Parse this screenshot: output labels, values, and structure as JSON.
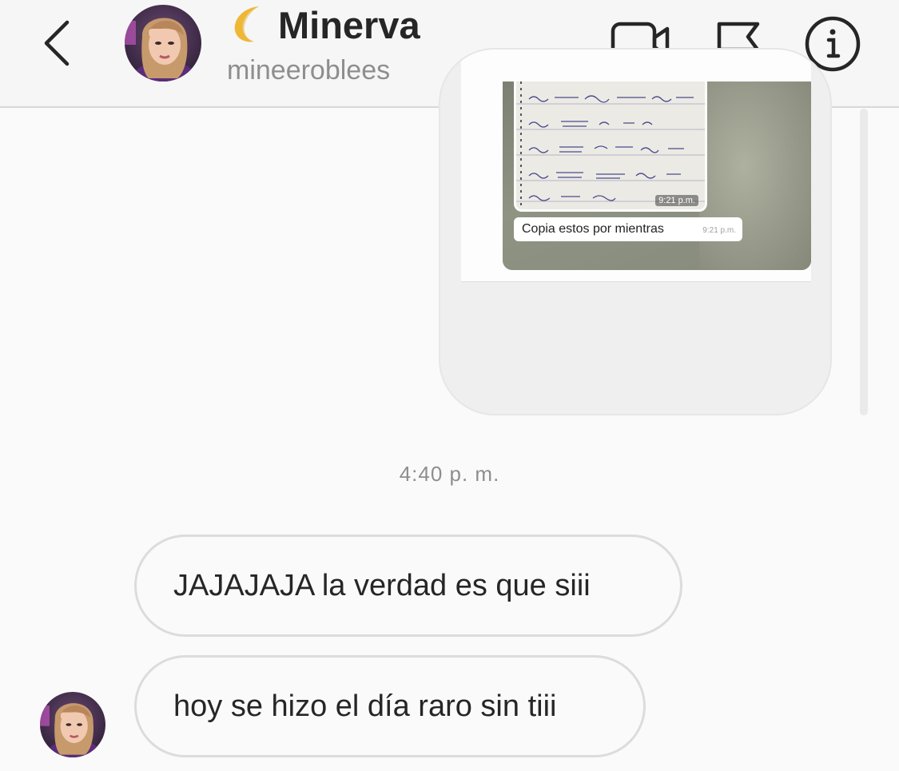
{
  "header": {
    "display_name": "Minerva",
    "username": "mineeroblees",
    "icons": {
      "back": "chevron-left-icon",
      "name_prefix": "crescent-moon-icon",
      "video": "video-camera-icon",
      "report": "flag-icon",
      "info": "info-icon"
    }
  },
  "shared_media": {
    "inner_time": "9:21 p.m.",
    "caption": "Copia estos por mientras",
    "caption_time": "9:21 p.m."
  },
  "conversation": {
    "timestamp": "4:40 p. m.",
    "messages": [
      {
        "text": "JAJAJAJA la verdad es que siii"
      },
      {
        "text": "hoy se hizo el día raro sin tiii"
      }
    ]
  },
  "colors": {
    "header_bg": "#f6f6f6",
    "bubble_border": "#dcdcdc",
    "secondary_text": "#8e8e8e",
    "primary_text": "#262626",
    "moon": "#f5c542"
  }
}
